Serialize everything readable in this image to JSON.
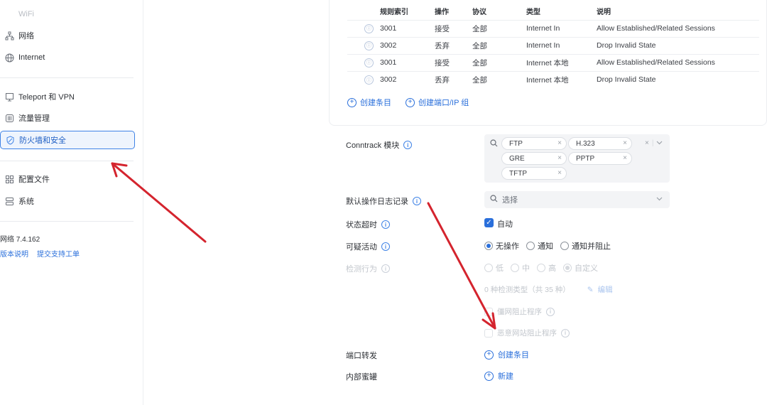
{
  "sidebar": {
    "items": [
      {
        "label": "WiFi",
        "icon": "wifi-icon"
      },
      {
        "label": "网络",
        "icon": "network-icon"
      },
      {
        "label": "Internet",
        "icon": "globe-icon"
      },
      {
        "label": "Teleport 和 VPN",
        "icon": "vpn-icon"
      },
      {
        "label": "流量管理",
        "icon": "traffic-icon"
      },
      {
        "label": "防火墙和安全",
        "icon": "shield-icon",
        "active": true
      },
      {
        "label": "配置文件",
        "icon": "profiles-icon"
      },
      {
        "label": "系统",
        "icon": "system-icon"
      }
    ],
    "version": "网络 7.4.162",
    "release_notes": "版本说明",
    "support": "提交支持工单"
  },
  "rules_table": {
    "headers": [
      "规则索引",
      "操作",
      "协议",
      "类型",
      "说明"
    ],
    "rows": [
      {
        "index": "3001",
        "action": "接受",
        "protocol": "全部",
        "type": "Internet In",
        "desc": "Allow Established/Related Sessions"
      },
      {
        "index": "3002",
        "action": "丢弃",
        "protocol": "全部",
        "type": "Internet In",
        "desc": "Drop Invalid State"
      },
      {
        "index": "3001",
        "action": "接受",
        "protocol": "全部",
        "type": "Internet 本地",
        "desc": "Allow Established/Related Sessions"
      },
      {
        "index": "3002",
        "action": "丢弃",
        "protocol": "全部",
        "type": "Internet 本地",
        "desc": "Drop Invalid State"
      }
    ],
    "create_entry": "创建条目",
    "create_port_group": "创建端口/IP 组"
  },
  "form": {
    "conntrack_label": "Conntrack 模块",
    "conntrack_tags": [
      "FTP",
      "H.323",
      "GRE",
      "PPTP",
      "TFTP"
    ],
    "default_log_label": "默认操作日志记录",
    "select_placeholder": "选择",
    "state_timeout_label": "状态超时",
    "state_timeout_value": "自动",
    "suspicious_label": "可疑活动",
    "suspicious_options": [
      "无操作",
      "通知",
      "通知并阻止"
    ],
    "suspicious_selected": 0,
    "detection_label": "检测行为",
    "detection_options": [
      "低",
      "中",
      "高",
      "自定义"
    ],
    "detection_selected": 3,
    "detection_types": "0 种检测类型（共 35 种）",
    "edit": "编辑",
    "blocker1": "僵网阻止程序",
    "blocker2": "恶意网站阻止程序",
    "port_forward_label": "端口转发",
    "port_forward_action": "创建条目",
    "hairpin_label": "内部蜜罐",
    "hairpin_action": "新建"
  }
}
